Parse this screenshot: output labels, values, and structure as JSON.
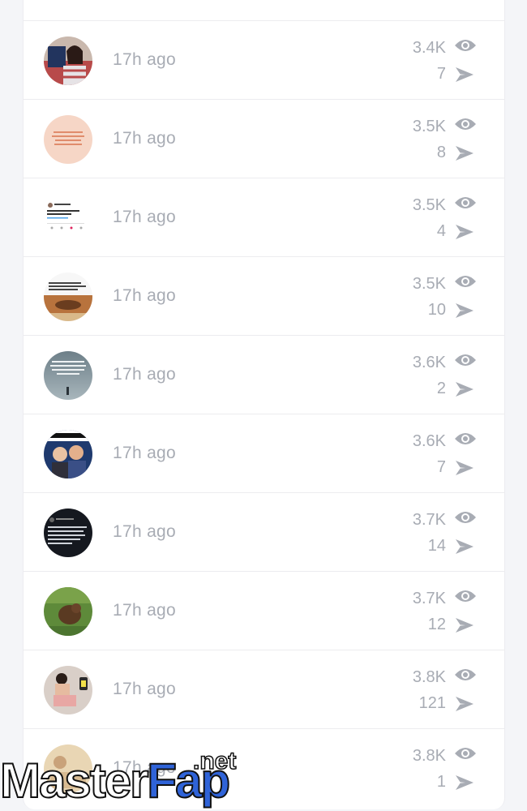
{
  "feed": {
    "items": [
      {
        "time": "17h ago",
        "views": "3.4K",
        "shares": "7",
        "avatar": "woman-flag-dress"
      },
      {
        "time": "17h ago",
        "views": "3.5K",
        "shares": "8",
        "avatar": "quote-pink"
      },
      {
        "time": "17h ago",
        "views": "3.5K",
        "shares": "4",
        "avatar": "tweet-screenshot"
      },
      {
        "time": "17h ago",
        "views": "3.5K",
        "shares": "10",
        "avatar": "text-with-photo"
      },
      {
        "time": "17h ago",
        "views": "3.6K",
        "shares": "2",
        "avatar": "quote-foggy"
      },
      {
        "time": "17h ago",
        "views": "3.6K",
        "shares": "7",
        "avatar": "friday-meme"
      },
      {
        "time": "17h ago",
        "views": "3.7K",
        "shares": "14",
        "avatar": "dark-tweet"
      },
      {
        "time": "17h ago",
        "views": "3.7K",
        "shares": "12",
        "avatar": "animal-grass"
      },
      {
        "time": "17h ago",
        "views": "3.8K",
        "shares": "121",
        "avatar": "woman-photo"
      },
      {
        "time": "17h ago",
        "views": "3.8K",
        "shares": "1",
        "avatar": "beige-photo"
      }
    ]
  },
  "watermark": {
    "brand_left": "Master",
    "brand_right": "Fap",
    "tld": ".net"
  },
  "colors": {
    "meta_text": "#a8acb4",
    "card_bg": "#ffffff",
    "page_bg": "#f4f5f8",
    "brand_blue": "#2f63d8"
  },
  "icons": {
    "views": "eye-icon",
    "shares": "send-icon"
  }
}
